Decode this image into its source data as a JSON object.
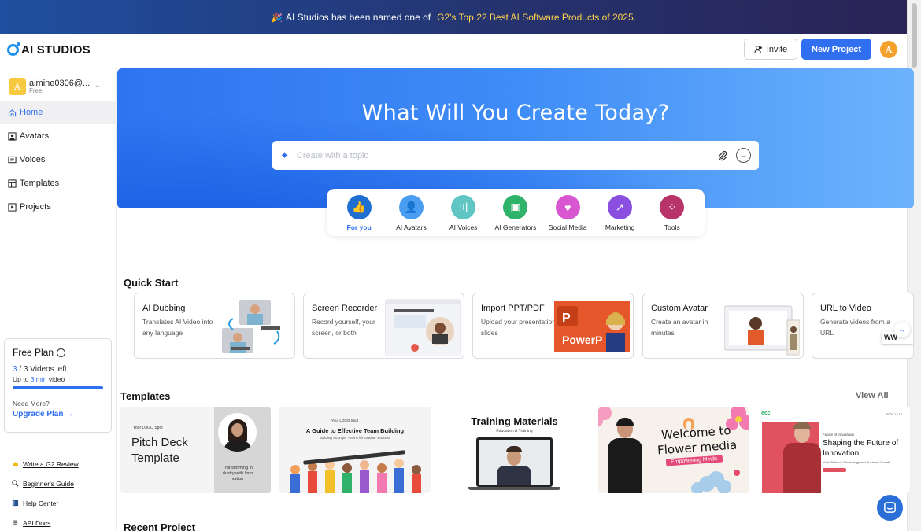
{
  "banner": {
    "emoji": "🎉",
    "text": "AI Studios has been named one of",
    "highlight": "G2's Top 22 Best AI Software Products of 2025."
  },
  "header": {
    "logo_text": "AI STUDIOS",
    "invite_label": "Invite",
    "new_project_label": "New Project",
    "user_initial": "A"
  },
  "sidebar": {
    "account": {
      "initial": "A",
      "email": "aimine0306@...",
      "plan": "Free"
    },
    "items": [
      {
        "label": "Home",
        "icon": "home-icon"
      },
      {
        "label": "Avatars",
        "icon": "avatar-icon"
      },
      {
        "label": "Voices",
        "icon": "voice-icon"
      },
      {
        "label": "Templates",
        "icon": "template-icon"
      },
      {
        "label": "Projects",
        "icon": "project-icon"
      }
    ],
    "plan_card": {
      "title": "Free Plan",
      "videos_used": "3",
      "videos_sep": " / 3 Videos left",
      "upto_prefix": "Up to ",
      "upto_value": "3 min",
      "upto_suffix": " video",
      "progress": 1.0,
      "need_more": "Need More?",
      "upgrade_label": "Upgrade Plan"
    },
    "links": [
      {
        "label": "Write a G2 Review",
        "icon": "crown-icon",
        "color": "#f2b90f"
      },
      {
        "label": "Beginner's Guide",
        "icon": "search-doc-icon",
        "color": "#333333"
      },
      {
        "label": "Help Center",
        "icon": "book-icon",
        "color": "#2b4f8c"
      },
      {
        "label": "API Docs",
        "icon": "doc-icon",
        "color": "#888888"
      }
    ]
  },
  "hero": {
    "title": "What Will You Create Today?",
    "search_placeholder": "Create with a topic"
  },
  "categories": [
    {
      "label": "For you",
      "color": "#1f6fd1",
      "glyph": "👍",
      "active": true
    },
    {
      "label": "AI Avatars",
      "color": "#4a9df0",
      "glyph": "👤",
      "active": false
    },
    {
      "label": "AI Voices",
      "color": "#5fc6c4",
      "glyph": "〣",
      "active": false
    },
    {
      "label": "AI Generators",
      "color": "#2fb36a",
      "glyph": "▣",
      "active": false
    },
    {
      "label": "Social Media",
      "color": "#d857d0",
      "glyph": "♥",
      "active": false
    },
    {
      "label": "Marketing",
      "color": "#8a4fe0",
      "glyph": "↗",
      "active": false
    },
    {
      "label": "Tools",
      "color": "#b8336a",
      "glyph": "⁘",
      "active": false
    }
  ],
  "quick_start": {
    "title": "Quick Start",
    "cards": [
      {
        "title": "AI Dubbing",
        "desc": "Translates AI Video into any language"
      },
      {
        "title": "Screen Recorder",
        "desc": "Record yourself, your screen, or both"
      },
      {
        "title": "Import PPT/PDF",
        "desc": "Upload your presentation slides",
        "thumb_text": "PowerP"
      },
      {
        "title": "Custom Avatar",
        "desc": "Create an avatar in minutes"
      },
      {
        "title": "URL to Video",
        "desc": "Generate videos from a URL",
        "thumb_text": "WW"
      }
    ]
  },
  "templates": {
    "title": "Templates",
    "view_all": "View All",
    "items": [
      {
        "title": "Pitch Deck Template",
        "logo": "Your LOGO Spot",
        "caption": "Transforming in dustry with Inno vation"
      },
      {
        "title": "A Guide to Effective Team Building",
        "logo": "Your LOGO Spot",
        "subtitle": "Building Stronger Teams for Greater Success"
      },
      {
        "title": "Training Materials",
        "subtitle": "Education & Training"
      },
      {
        "title": "Welcome to Flower media",
        "subtitle": "Empowering Minds"
      },
      {
        "title": "Shaping the Future of Innovation",
        "kicker": "Future of Innovation",
        "desc": "Your Pitstop in Technology and Business Growth",
        "date": "0000.12.12",
        "logo": "ecc"
      }
    ]
  },
  "recent": {
    "title": "Recent Project"
  }
}
